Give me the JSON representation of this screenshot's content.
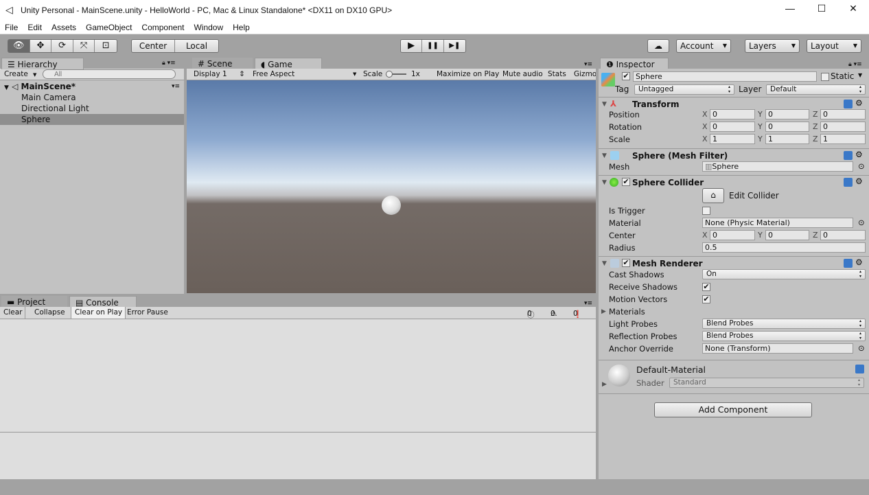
{
  "window": {
    "title": "Unity Personal - MainScene.unity - HelloWorld - PC, Mac & Linux Standalone* <DX11 on DX10 GPU>",
    "minimize": "—",
    "maximize": "☐",
    "close": "✕"
  },
  "menu": [
    "File",
    "Edit",
    "Assets",
    "GameObject",
    "Component",
    "Window",
    "Help"
  ],
  "toolbar": {
    "tools": [
      "👁",
      "✥",
      "⟳",
      "⤧",
      "⊡"
    ],
    "pivot": "Center",
    "space": "Local",
    "play": "▶",
    "pause": "❚❚",
    "step": "▶❚",
    "account": "Account",
    "layers": "Layers",
    "layout": "Layout"
  },
  "hierarchy": {
    "tab": "Hierarchy",
    "create": "Create",
    "search_placeholder": "All",
    "scene": "MainScene*",
    "items": [
      "Main Camera",
      "Directional Light",
      "Sphere"
    ],
    "selected": "Sphere"
  },
  "game": {
    "tabs": [
      "Scene",
      "Game"
    ],
    "active_tab": "Game",
    "display": "Display 1",
    "aspect": "Free Aspect",
    "scale_label": "Scale",
    "scale_value": "1x",
    "buttons": [
      "Maximize on Play",
      "Mute audio",
      "Stats",
      "Gizmos"
    ]
  },
  "console": {
    "tabs": [
      "Project",
      "Console"
    ],
    "active_tab": "Console",
    "buttons": [
      "Clear",
      "Collapse",
      "Clear on Play",
      "Error Pause"
    ],
    "counts": {
      "info": "0",
      "warning": "0",
      "error": "0"
    }
  },
  "inspector": {
    "tab": "Inspector",
    "name": "Sphere",
    "static": "Static",
    "tag_label": "Tag",
    "tag": "Untagged",
    "layer_label": "Layer",
    "layer": "Default",
    "transform": {
      "title": "Transform",
      "rows": [
        {
          "label": "Position",
          "x": "0",
          "y": "0",
          "z": "0"
        },
        {
          "label": "Rotation",
          "x": "0",
          "y": "0",
          "z": "0"
        },
        {
          "label": "Scale",
          "x": "1",
          "y": "1",
          "z": "1"
        }
      ]
    },
    "mesh_filter": {
      "title": "Sphere (Mesh Filter)",
      "mesh_label": "Mesh",
      "mesh": "Sphere"
    },
    "collider": {
      "title": "Sphere Collider",
      "edit": "Edit Collider",
      "is_trigger": "Is Trigger",
      "material_label": "Material",
      "material": "None (Physic Material)",
      "center_label": "Center",
      "center": {
        "x": "0",
        "y": "0",
        "z": "0"
      },
      "radius_label": "Radius",
      "radius": "0.5"
    },
    "renderer": {
      "title": "Mesh Renderer",
      "cast_label": "Cast Shadows",
      "cast": "On",
      "receive_label": "Receive Shadows",
      "motion_label": "Motion Vectors",
      "materials_label": "Materials",
      "light_label": "Light Probes",
      "light": "Blend Probes",
      "refl_label": "Reflection Probes",
      "refl": "Blend Probes",
      "anchor_label": "Anchor Override",
      "anchor": "None (Transform)"
    },
    "material": {
      "name": "Default-Material",
      "shader_label": "Shader",
      "shader": "Standard"
    },
    "add_component": "Add Component"
  },
  "axes": {
    "x": "X",
    "y": "Y",
    "z": "Z"
  }
}
